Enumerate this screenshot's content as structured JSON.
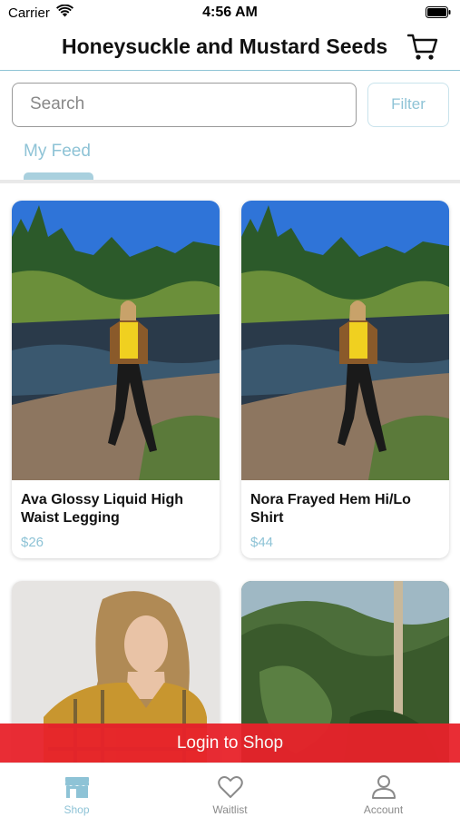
{
  "status_bar": {
    "carrier": "Carrier",
    "time": "4:56 AM"
  },
  "header": {
    "title": "Honeysuckle and Mustard Seeds"
  },
  "search": {
    "placeholder": "Search",
    "filter_label": "Filter"
  },
  "tabs": [
    {
      "label": "My Feed",
      "active": true
    }
  ],
  "products": [
    {
      "name": "Ava Glossy Liquid High Waist Legging",
      "price": "$26"
    },
    {
      "name": "Nora Frayed Hem Hi/Lo Shirt",
      "price": "$44"
    }
  ],
  "banner": {
    "label": "Login to Shop",
    "color": "#e8222a"
  },
  "tab_bar": [
    {
      "label": "Shop",
      "icon": "store-icon",
      "active": true
    },
    {
      "label": "Waitlist",
      "icon": "heart-icon",
      "active": false
    },
    {
      "label": "Account",
      "icon": "person-icon",
      "active": false
    }
  ],
  "colors": {
    "accent": "#8ec3d6",
    "banner": "#e8222a"
  }
}
